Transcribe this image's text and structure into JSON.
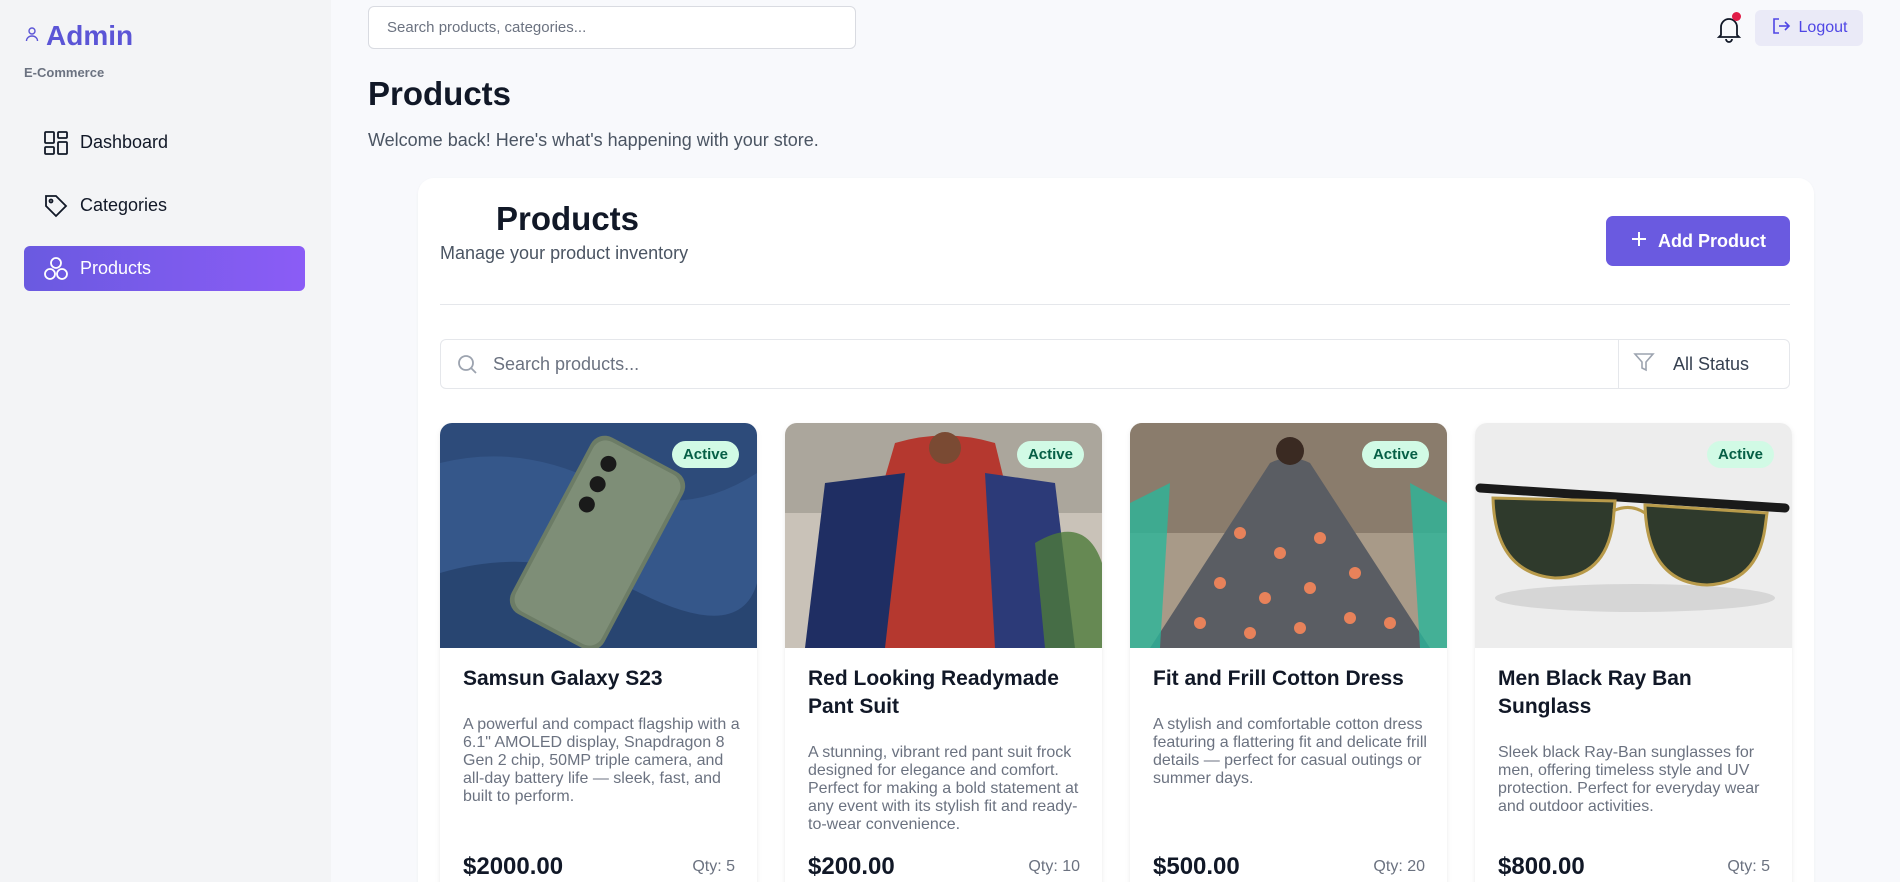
{
  "brand": {
    "title": "Admin",
    "subtitle": "E-Commerce"
  },
  "sidebar": {
    "items": [
      {
        "label": "Dashboard",
        "icon": "dashboard-icon",
        "active": false
      },
      {
        "label": "Categories",
        "icon": "tag-icon",
        "active": false
      },
      {
        "label": "Products",
        "icon": "products-icon",
        "active": true
      }
    ]
  },
  "topbar": {
    "search_placeholder": "Search products, categories...",
    "logout_label": "Logout"
  },
  "page": {
    "title": "Products",
    "subtitle": "Welcome back! Here's what's happening with your store."
  },
  "panel": {
    "title": "Products",
    "subtitle": "Manage your product inventory",
    "add_button": "Add Product",
    "search_placeholder": "Search products...",
    "status_filter": "All Status"
  },
  "products": [
    {
      "name": "Samsun Galaxy S23",
      "description": "A powerful and compact flagship with a 6.1\" AMOLED display, Snapdragon 8 Gen 2 chip, 50MP triple camera, and all-day battery life — sleek, fast, and built to perform.",
      "price": "$2000.00",
      "qty": "Qty: 5",
      "status": "Active"
    },
    {
      "name": "Red Looking Readymade Pant Suit",
      "description": "A stunning, vibrant red pant suit frock designed for elegance and comfort. Perfect for making a bold statement at any event with its stylish fit and ready-to-wear convenience.",
      "price": "$200.00",
      "qty": "Qty: 10",
      "status": "Active"
    },
    {
      "name": "Fit and Frill Cotton Dress",
      "description": "A stylish and comfortable cotton dress featuring a flattering fit and delicate frill details — perfect for casual outings or summer days.",
      "price": "$500.00",
      "qty": "Qty: 20",
      "status": "Active"
    },
    {
      "name": "Men Black Ray Ban Sunglass",
      "description": "Sleek black Ray-Ban sunglasses for men, offering timeless style and UV protection. Perfect for everyday wear and outdoor activities.",
      "price": "$800.00",
      "qty": "Qty: 5",
      "status": "Active"
    }
  ],
  "colors": {
    "accent": "#6a5ae0",
    "brand": "#5b55d6",
    "active_badge_bg": "#d1fae5",
    "active_badge_text": "#065f46",
    "notification_dot": "#e11d48"
  }
}
